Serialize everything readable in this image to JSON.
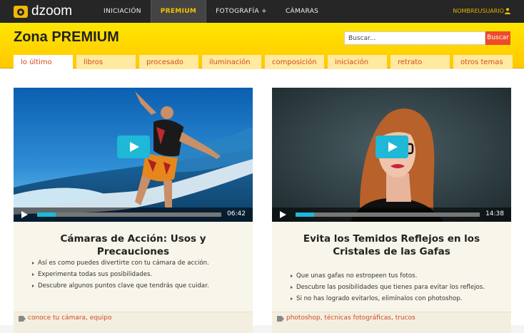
{
  "header": {
    "logo_text": "dzoom",
    "nav": [
      "INICIACIÓN",
      "PREMIUM",
      "FOTOGRAFÍA +",
      "CÁMARAS"
    ],
    "active_nav": "PREMIUM",
    "user_name": "NOMBREUSUARIO",
    "user_icon": "user-icon"
  },
  "banner": {
    "title": "Zona PREMIUM",
    "search_placeholder": "Buscar...",
    "search_button": "Buscar"
  },
  "tabs": [
    "lo último",
    "libros",
    "procesado",
    "iluminación",
    "composición",
    "iniciación",
    "retrato",
    "otros temas"
  ],
  "active_tab": "lo último",
  "cards": [
    {
      "duration": "06:42",
      "progress": 0.1,
      "title": "Cámaras de Acción: Usos y Precauciones",
      "bullets": [
        "Así es como puedes divertirte con tu cámara de acción.",
        "Experimenta todas sus posibilidades.",
        "Descubre algunos puntos clave que tendrás que cuidar."
      ],
      "tags": "conoce tu cámara, equipo"
    },
    {
      "duration": "14:38",
      "progress": 0.1,
      "title": "Evita los Temidos Reflejos en los Cristales de las Gafas",
      "bullets": [
        "Que unas gafas no estropeen tus fotos.",
        "Descubre las posibilidades que tienes para evitar los reflejos.",
        "Si no has logrado evitarlos, elimínalos con photoshop."
      ],
      "tags": "photoshop, técnicas fotográficas, trucos"
    }
  ],
  "colors": {
    "accent": "#ffd400",
    "link": "#d24a1f",
    "play": "#1fb8d6",
    "topbar": "#262626"
  }
}
